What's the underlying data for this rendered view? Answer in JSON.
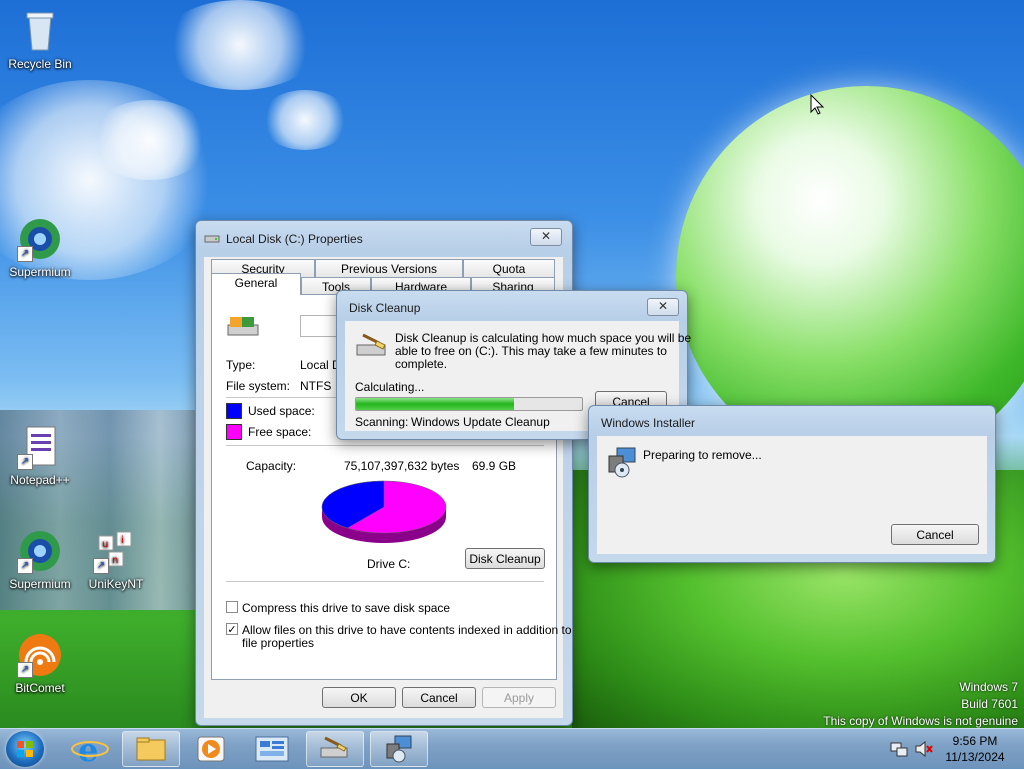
{
  "desktop": {
    "icons": [
      {
        "label": "Recycle Bin"
      },
      {
        "label": "Supermium"
      },
      {
        "label": "Notepad++"
      },
      {
        "label": "Supermium"
      },
      {
        "label": "UniKeyNT"
      },
      {
        "label": "BitComet"
      }
    ],
    "watermark": {
      "line1": "Windows 7",
      "line2": "Build 7601",
      "line3": "This copy of Windows is not genuine"
    }
  },
  "properties_dialog": {
    "title": "Local Disk (C:) Properties",
    "tabs_row1": [
      "Security",
      "Previous Versions",
      "Quota"
    ],
    "tabs_row2": [
      "General",
      "Tools",
      "Hardware",
      "Sharing"
    ],
    "active_tab": "General",
    "type_label": "Type:",
    "type_value": "Local Disk",
    "fs_label": "File system:",
    "fs_value": "NTFS",
    "used_label": "Used space:",
    "free_label": "Free space:",
    "capacity_label": "Capacity:",
    "capacity_bytes": "75,107,397,632 bytes",
    "capacity_gb": "69.9 GB",
    "drive_label": "Drive C:",
    "disk_cleanup_button": "Disk Cleanup",
    "compress_label": "Compress this drive to save disk space",
    "compress_checked": false,
    "index_label_1": "Allow files on this drive to have contents indexed in addition to",
    "index_label_2": "file properties",
    "index_checked": true,
    "ok_button": "OK",
    "cancel_button": "Cancel",
    "apply_button": "Apply",
    "colors": {
      "used": "#0000ff",
      "free": "#ff00ff"
    },
    "used_fraction": 0.4
  },
  "cleanup_dialog": {
    "title": "Disk Cleanup",
    "message_1": "Disk Cleanup is calculating how much space you will be",
    "message_2": "able to free on  (C:). This may take a few minutes to",
    "message_3": "complete.",
    "calculating_label": "Calculating...",
    "progress": 0.7,
    "scanning_label": "Scanning:",
    "scanning_value": "Windows Update Cleanup",
    "cancel_button": "Cancel",
    "close_glyph": "✕"
  },
  "installer_dialog": {
    "title": "Windows Installer",
    "message": "Preparing to remove...",
    "cancel_button": "Cancel"
  },
  "taskbar": {
    "time": "9:56 PM",
    "date": "11/13/2024"
  }
}
